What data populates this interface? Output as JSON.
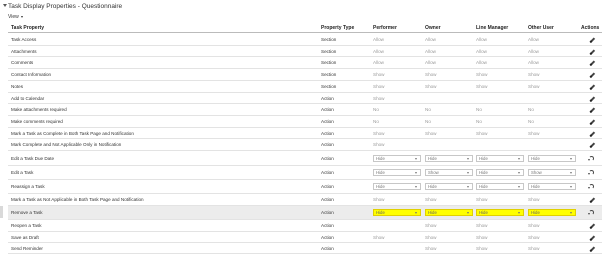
{
  "header": {
    "title": "Task Display Properties - Questionnaire",
    "view_label": "View"
  },
  "table": {
    "columns": [
      "Task Property",
      "Property Type",
      "Performer",
      "Owner",
      "Line Manager",
      "Other User",
      "Actions"
    ],
    "rows": [
      {
        "property": "Task Access",
        "type": "Section",
        "performer": "Allow",
        "owner": "Allow",
        "line_manager": "Allow",
        "other_user": "Allow",
        "action_icon": "pencil-icon"
      },
      {
        "property": "Attachments",
        "type": "Section",
        "performer": "Allow",
        "owner": "Allow",
        "line_manager": "Allow",
        "other_user": "Allow",
        "action_icon": "pencil-icon"
      },
      {
        "property": "Comments",
        "type": "Section",
        "performer": "Allow",
        "owner": "Allow",
        "line_manager": "Allow",
        "other_user": "Allow",
        "action_icon": "pencil-icon"
      },
      {
        "property": "Contact Information",
        "type": "Section",
        "performer": "Show",
        "owner": "Show",
        "line_manager": "Show",
        "other_user": "Show",
        "action_icon": "pencil-icon"
      },
      {
        "property": "Notes",
        "type": "Section",
        "performer": "Show",
        "owner": "Show",
        "line_manager": "Show",
        "other_user": "Show",
        "action_icon": "pencil-icon"
      },
      {
        "property": "Add to Calendar",
        "type": "Action",
        "performer": "Show",
        "owner": "",
        "line_manager": "",
        "other_user": "",
        "action_icon": "pencil-icon"
      },
      {
        "property": "Make attachments required",
        "type": "Action",
        "performer": "No",
        "owner": "No",
        "line_manager": "No",
        "other_user": "No",
        "action_icon": "pencil-icon"
      },
      {
        "property": "Make comments required",
        "type": "Action",
        "performer": "No",
        "owner": "No",
        "line_manager": "No",
        "other_user": "No",
        "action_icon": "pencil-icon"
      },
      {
        "property": "Mark a Task as Complete in Both Task Page and Notification",
        "type": "Action",
        "performer": "Show",
        "owner": "Show",
        "line_manager": "Show",
        "other_user": "Show",
        "action_icon": "pencil-icon"
      },
      {
        "property": "Mark Complete and Not Applicable Only in Notification",
        "type": "Action",
        "performer": "Show",
        "owner": "",
        "line_manager": "",
        "other_user": "",
        "action_icon": "pencil-icon"
      },
      {
        "property": "Edit a Task Due Date",
        "type": "Action",
        "performer": "Hide",
        "owner": "Hide",
        "line_manager": "Hide",
        "other_user": "Hide",
        "dropdown": true,
        "action_icon": "undo-icon"
      },
      {
        "property": "Edit a Task",
        "type": "Action",
        "performer": "Hide",
        "owner": "Show",
        "line_manager": "Hide",
        "other_user": "Show",
        "dropdown": true,
        "action_icon": "undo-icon"
      },
      {
        "property": "Reassign a Task",
        "type": "Action",
        "performer": "Hide",
        "owner": "Hide",
        "line_manager": "Hide",
        "other_user": "Hide",
        "dropdown": true,
        "action_icon": "undo-icon"
      },
      {
        "property": "Mark a Task as Not Applicable in Both Task Page and Notification",
        "type": "Action",
        "performer": "Show",
        "owner": "Show",
        "line_manager": "Show",
        "other_user": "Show",
        "action_icon": "pencil-icon"
      },
      {
        "property": "Remove a Task",
        "type": "Action",
        "performer": "Hide",
        "owner": "Hide",
        "line_manager": "Hide",
        "other_user": "Hide",
        "dropdown": true,
        "highlighted": true,
        "action_icon": "undo-icon"
      },
      {
        "property": "Reopen a Task",
        "type": "Action",
        "performer": "",
        "owner": "Show",
        "line_manager": "Show",
        "other_user": "Show",
        "action_icon": "pencil-icon"
      },
      {
        "property": "Save as Draft",
        "type": "Action",
        "performer": "Show",
        "owner": "Show",
        "line_manager": "Show",
        "other_user": "Show",
        "action_icon": "pencil-icon"
      },
      {
        "property": "Send Reminder",
        "type": "Action",
        "performer": "",
        "owner": "Show",
        "line_manager": "Show",
        "other_user": "Show",
        "action_icon": "pencil-icon"
      }
    ]
  },
  "colors": {
    "highlight_marker": "#ffff00",
    "row_selected_bg": "#ececec"
  }
}
